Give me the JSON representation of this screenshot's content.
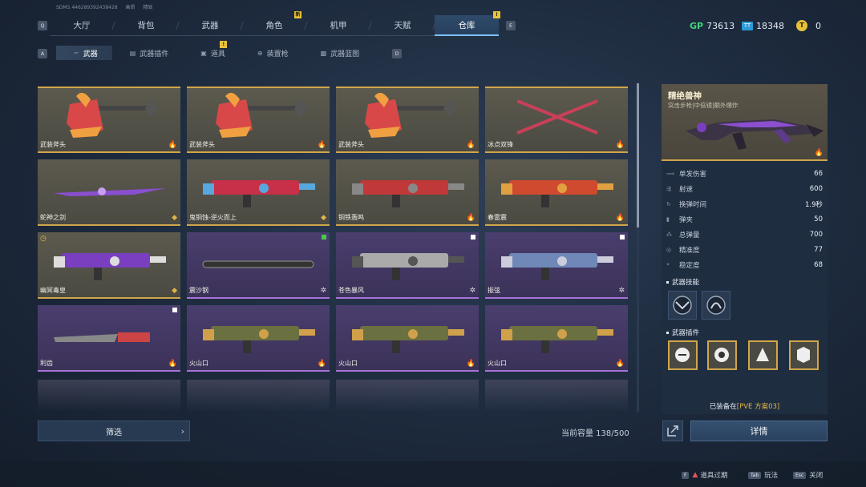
{
  "account": {
    "id": "SDMS  446289392438428",
    "label": "画质",
    "value": "精致"
  },
  "top_nav": {
    "key_left": "Q",
    "key_right": "E",
    "tabs": [
      {
        "label": "大厅"
      },
      {
        "label": "背包"
      },
      {
        "label": "武器"
      },
      {
        "label": "角色",
        "badge": "新"
      },
      {
        "label": "机甲"
      },
      {
        "label": "天赋"
      },
      {
        "label": "仓库",
        "badge": "!",
        "active": true
      }
    ]
  },
  "currency": {
    "gp_label": "GP",
    "gp_value": "73613",
    "tt_label": "TT",
    "tt_value": "18348",
    "coin_label": "T",
    "coin_value": "0"
  },
  "sub_nav": {
    "key_left": "A",
    "key_right": "D",
    "tabs": [
      {
        "label": "武器",
        "icon": "gun-icon",
        "active": true
      },
      {
        "label": "武器插件",
        "icon": "plugin-icon"
      },
      {
        "label": "道具",
        "icon": "item-icon",
        "badge": "!"
      },
      {
        "label": "装置枪",
        "icon": "device-gun-icon"
      },
      {
        "label": "武器蓝图",
        "icon": "blueprint-icon"
      }
    ]
  },
  "weapons": [
    {
      "name": "武装斧头",
      "rarity": "gold",
      "tag": "fire"
    },
    {
      "name": "武装斧头",
      "rarity": "gold",
      "tag": "fire"
    },
    {
      "name": "武装斧头",
      "rarity": "gold",
      "tag": "fire"
    },
    {
      "name": "冰点双锋",
      "rarity": "gold",
      "tag": "fire"
    },
    {
      "name": "蛇神之剑",
      "rarity": "gold",
      "tag": "green"
    },
    {
      "name": "鬼铜蚀-逆火而上",
      "rarity": "gold",
      "tag": "green"
    },
    {
      "name": "铜铁轰鸣",
      "rarity": "gold",
      "tag": "fire"
    },
    {
      "name": "春雷震",
      "rarity": "gold",
      "tag": "fire"
    },
    {
      "name": "幽冥毒皇",
      "rarity": "gold",
      "tag": "green",
      "timed": true
    },
    {
      "name": "震沙钢",
      "rarity": "purple",
      "tag": "star",
      "corner": "green"
    },
    {
      "name": "苍色暴风",
      "rarity": "purple",
      "tag": "star",
      "corner": "white"
    },
    {
      "name": "振弦",
      "rarity": "purple",
      "tag": "star",
      "corner": "white"
    },
    {
      "name": "利齿",
      "rarity": "purple",
      "tag": "fire",
      "corner": "white"
    },
    {
      "name": "火山口",
      "rarity": "purple",
      "tag": "fire"
    },
    {
      "name": "火山口",
      "rarity": "purple",
      "tag": "fire"
    },
    {
      "name": "火山口",
      "rarity": "purple",
      "tag": "fire"
    }
  ],
  "filter_label": "筛选",
  "capacity_label": "当前容量 138/500",
  "detail": {
    "title": "精绝兽神",
    "subtitle": "突击步枪|中倍镜|额外爆炸",
    "stats": [
      {
        "label": "单发伤害",
        "value": "66"
      },
      {
        "label": "射速",
        "value": "600"
      },
      {
        "label": "换弹时间",
        "value": "1.9秒"
      },
      {
        "label": "弹夹",
        "value": "50"
      },
      {
        "label": "总弹量",
        "value": "700"
      },
      {
        "label": "精准度",
        "value": "77"
      },
      {
        "label": "稳定度",
        "value": "68"
      }
    ],
    "skills_title": "武器技能",
    "plugins_title": "武器插件",
    "equipped_prefix": "已装备在",
    "equipped_plan": "[PVE 方案03]",
    "detail_button": "详情"
  },
  "footer": [
    {
      "key": "F",
      "label": "道具过期"
    },
    {
      "key": "Tab",
      "label": "玩法"
    },
    {
      "key": "Esc",
      "label": "关闭"
    }
  ]
}
